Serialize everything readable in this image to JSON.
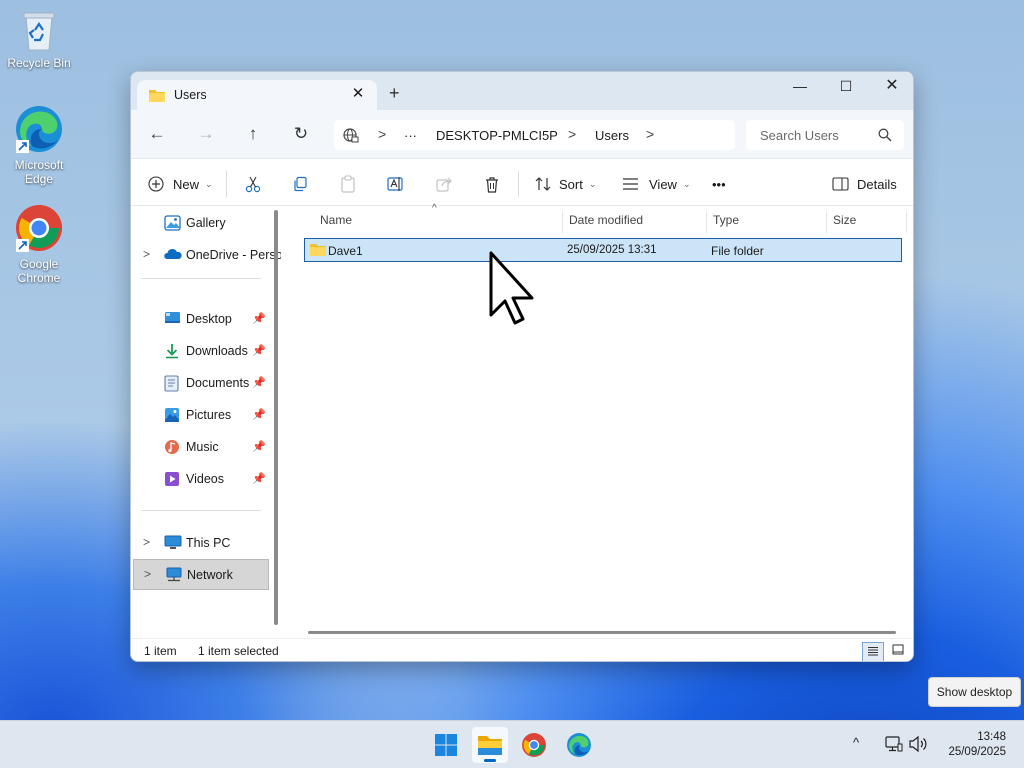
{
  "desktop": {
    "icons": [
      {
        "label": "Recycle Bin",
        "icon": "recycle-bin-icon"
      },
      {
        "label": "Microsoft Edge",
        "icon": "edge-icon"
      },
      {
        "label": "Google Chrome",
        "icon": "chrome-icon"
      }
    ]
  },
  "window": {
    "tab_title": "Users",
    "tab_close": "✕",
    "new_tab": "+",
    "controls": {
      "minimize": "—",
      "maximize": "☐",
      "close": "✕"
    },
    "nav": {
      "back": "←",
      "forward": "→",
      "up": "↑",
      "refresh": "↻"
    },
    "address": {
      "overflow": "···",
      "segments": [
        "DESKTOP-PMLCI5P",
        "Users"
      ],
      "separator": ">"
    },
    "search": {
      "placeholder": "Search Users"
    },
    "toolbar": {
      "new_label": "New",
      "sort_label": "Sort",
      "view_label": "View",
      "more_label": "•••",
      "details_label": "Details"
    },
    "sidebar": {
      "items": [
        {
          "label": "Gallery",
          "icon": "gallery-icon"
        },
        {
          "label": "OneDrive - Personal",
          "icon": "onedrive-icon"
        },
        {
          "label": "Desktop",
          "icon": "desktop-folder-icon",
          "pinned": true
        },
        {
          "label": "Downloads",
          "icon": "downloads-icon",
          "pinned": true
        },
        {
          "label": "Documents",
          "icon": "documents-icon",
          "pinned": true
        },
        {
          "label": "Pictures",
          "icon": "pictures-icon",
          "pinned": true
        },
        {
          "label": "Music",
          "icon": "music-icon",
          "pinned": true
        },
        {
          "label": "Videos",
          "icon": "videos-icon",
          "pinned": true
        },
        {
          "label": "This PC",
          "icon": "this-pc-icon"
        },
        {
          "label": "Network",
          "icon": "network-icon",
          "selected": true
        }
      ]
    },
    "columns": {
      "name": "Name",
      "date": "Date modified",
      "type": "Type",
      "size": "Size"
    },
    "rows": [
      {
        "name": "Dave1",
        "date": "25/09/2025 13:31",
        "type": "File folder",
        "size": "",
        "selected": true
      }
    ],
    "status": {
      "count": "1 item",
      "selection": "1 item selected"
    }
  },
  "tooltip": "Show desktop",
  "taskbar": {
    "apps": [
      {
        "name": "start",
        "icon": "windows-logo-icon"
      },
      {
        "name": "file-explorer",
        "icon": "file-explorer-icon",
        "active": true
      },
      {
        "name": "chrome",
        "icon": "chrome-icon"
      },
      {
        "name": "edge",
        "icon": "edge-icon"
      }
    ],
    "tray_chevron": "^",
    "time": "13:48",
    "date": "25/09/2025"
  }
}
